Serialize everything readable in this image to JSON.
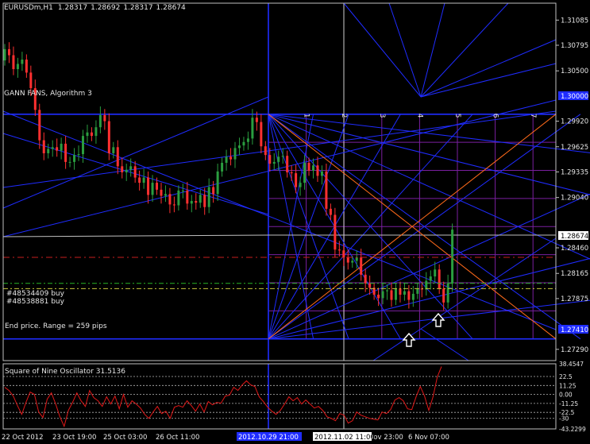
{
  "colors": {
    "bg": "#000000",
    "axis": "#c0c0c0",
    "fan_blue": "#1f2cff",
    "grid_purple": "#7a1fa0",
    "fan_orange": "#ff6a1a",
    "bull": "#2a9d3f",
    "bear": "#ff3030",
    "price_line": "#c0c0c0",
    "buy_green": "#28b428",
    "buy_yellow": "#c8c83c",
    "stop_red": "#c81e1e",
    "osc_red": "#e01818"
  },
  "header": {
    "symbol": "EURUSDm,H1",
    "open": "1.28317",
    "high": "1.28692",
    "low": "1.28317",
    "close": "1.28674"
  },
  "labels": {
    "fan_title": "GANN FANS, Algorithm 3",
    "order_1": "#48534409 buy",
    "order_2": "#48538881 buy",
    "end_price": "End price. Range = 259 pips",
    "osc_title": "Square of Nine Oscillator 31.5136",
    "grid_numbers": [
      "1",
      "2",
      "3",
      "4",
      "5",
      "6",
      "7"
    ],
    "fan_top_badge": "1.30000",
    "fan_bottom_badge": "1.27410",
    "price_badge": "1.28674",
    "time_badge_left": "2012.10.29 21:00",
    "time_badge_right": "2012.11.02 11:00"
  },
  "chart_data": [
    {
      "type": "candlestick",
      "title": "EURUSDm,H1",
      "price_ticks": [
        "1.31085",
        "1.30795",
        "1.30500",
        "1.29920",
        "1.29625",
        "1.29335",
        "1.29040",
        "1.28460",
        "1.28165",
        "1.27875",
        "1.27290"
      ],
      "current_price": 1.28674,
      "x_tick_labels": [
        "22 Oct 2012",
        "23 Oct 19:00",
        "25 Oct 03:00",
        "26 Oct 11:00",
        "29 Oct 21:00",
        "1",
        "Nov 23:00",
        "6 Nov 07:00"
      ],
      "closes": [
        1.3075,
        1.3068,
        1.3052,
        1.3058,
        1.3063,
        1.3048,
        1.303,
        1.3005,
        1.297,
        1.2955,
        1.296,
        1.2962,
        1.2958,
        1.2966,
        1.2945,
        1.2945,
        1.2953,
        1.2954,
        1.2975,
        1.2979,
        1.2975,
        1.2985,
        1.2999,
        1.2992,
        1.2955,
        1.2962,
        1.294,
        1.2933,
        1.2936,
        1.294,
        1.2927,
        1.2921,
        1.2927,
        1.2907,
        1.2921,
        1.2913,
        1.2906,
        1.2908,
        1.2896,
        1.2895,
        1.2912,
        1.2912,
        1.2897,
        1.29,
        1.2898,
        1.2907,
        1.2893,
        1.2916,
        1.2908,
        1.2934,
        1.2944,
        1.2951,
        1.2948,
        1.2961,
        1.2964,
        1.2968,
        1.2972,
        1.2996,
        1.2991,
        1.2963,
        1.2953,
        1.2943,
        1.2945,
        1.2951,
        1.2952,
        1.2933,
        1.2932,
        1.2916,
        1.2921,
        1.2944,
        1.2935,
        1.2941,
        1.2929,
        1.2934,
        1.2891,
        1.2884,
        1.2844,
        1.2843,
        1.2835,
        1.2829,
        1.2831,
        1.2835,
        1.2815,
        1.2805,
        1.28,
        1.2792,
        1.2788,
        1.2796,
        1.2797,
        1.2786,
        1.2799,
        1.2792,
        1.2796,
        1.2786,
        1.2793,
        1.2799,
        1.2798,
        1.2808,
        1.2813,
        1.2821,
        1.2799,
        1.2783,
        1.2805,
        1.2867
      ],
      "order_levels": [
        1.2805,
        1.2799
      ],
      "stop_level": 1.2835,
      "markers": [
        "buy-arrow",
        "buy-arrow"
      ]
    },
    {
      "type": "line",
      "title": "Square of Nine Oscillator 31.5136",
      "value": 31.5136,
      "ticks": [
        "38.4547",
        "22.5",
        "11.25",
        "0.00",
        "-11.25",
        "-22.5",
        "-30",
        "-43.2299"
      ],
      "ylim": [
        -43.2299,
        38.4547
      ],
      "values": [
        9,
        5,
        -2,
        -14,
        -25,
        -10,
        3,
        0,
        -22,
        -29,
        -6,
        2,
        -12,
        -28,
        -40,
        -20,
        -10,
        2,
        -8,
        -15,
        5,
        -4,
        -8,
        -15,
        -3,
        -12,
        -2,
        -18,
        0,
        -16,
        -8,
        -12,
        -17,
        -25,
        -30,
        -22,
        -15,
        -24,
        -21,
        -30,
        -16,
        -14,
        -16,
        -8,
        -14,
        -21,
        -12,
        -22,
        -9,
        -13,
        -10,
        -11,
        -2,
        -1,
        9,
        5,
        12,
        17,
        12,
        10,
        -3,
        -9,
        -16,
        -21,
        -25,
        -20,
        -12,
        -3,
        -8,
        -4,
        -12,
        -7,
        -12,
        -17,
        -15,
        -20,
        -28,
        -30,
        -33,
        -24,
        -26,
        -36,
        -33,
        -22,
        -26,
        -28,
        -30,
        -31,
        -32,
        -22,
        -24,
        -19,
        -7,
        -4,
        -8,
        -18,
        -19,
        -3,
        10,
        -2,
        -20,
        -3,
        22,
        35
      ]
    }
  ]
}
